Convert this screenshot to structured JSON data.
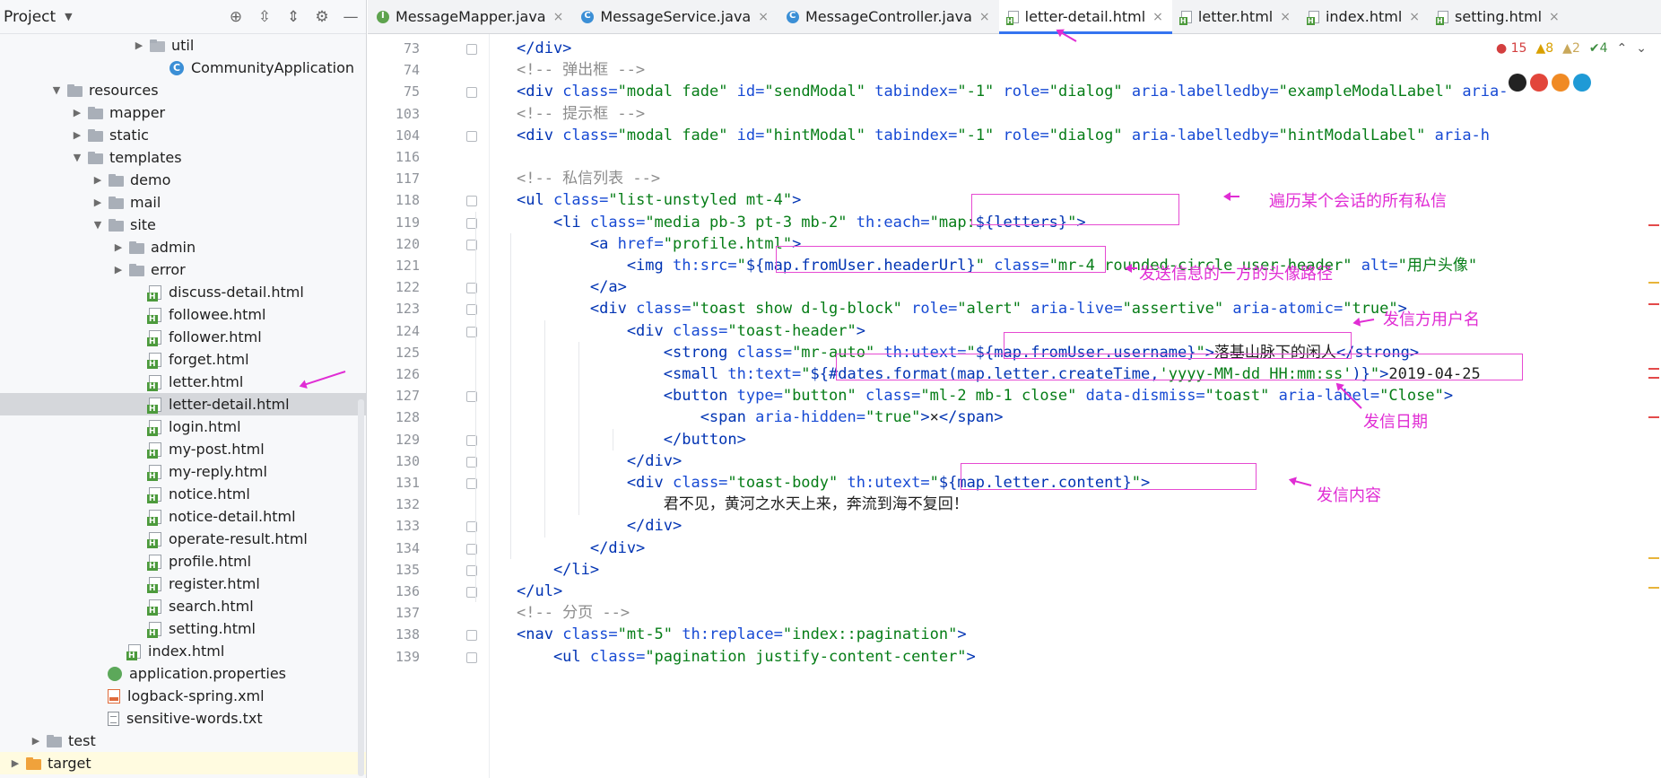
{
  "project_panel": {
    "title": "Project",
    "tree": [
      {
        "label": "util",
        "indent": 6,
        "type": "pkg",
        "arrow": "▶"
      },
      {
        "label": "CommunityApplication",
        "indent": 7,
        "type": "cls",
        "arrow": ""
      },
      {
        "label": "resources",
        "indent": 2,
        "type": "folder",
        "arrow": "▼"
      },
      {
        "label": "mapper",
        "indent": 3,
        "type": "folder",
        "arrow": "▶"
      },
      {
        "label": "static",
        "indent": 3,
        "type": "folder",
        "arrow": "▶"
      },
      {
        "label": "templates",
        "indent": 3,
        "type": "folder",
        "arrow": "▼"
      },
      {
        "label": "demo",
        "indent": 4,
        "type": "folder",
        "arrow": "▶"
      },
      {
        "label": "mail",
        "indent": 4,
        "type": "folder",
        "arrow": "▶"
      },
      {
        "label": "site",
        "indent": 4,
        "type": "folder",
        "arrow": "▼"
      },
      {
        "label": "admin",
        "indent": 5,
        "type": "folder",
        "arrow": "▶"
      },
      {
        "label": "error",
        "indent": 5,
        "type": "folder",
        "arrow": "▶"
      },
      {
        "label": "discuss-detail.html",
        "indent": 6,
        "type": "html",
        "arrow": ""
      },
      {
        "label": "followee.html",
        "indent": 6,
        "type": "html",
        "arrow": ""
      },
      {
        "label": "follower.html",
        "indent": 6,
        "type": "html",
        "arrow": ""
      },
      {
        "label": "forget.html",
        "indent": 6,
        "type": "html",
        "arrow": ""
      },
      {
        "label": "letter.html",
        "indent": 6,
        "type": "html",
        "arrow": ""
      },
      {
        "label": "letter-detail.html",
        "indent": 6,
        "type": "html",
        "arrow": "",
        "selected": true
      },
      {
        "label": "login.html",
        "indent": 6,
        "type": "html",
        "arrow": ""
      },
      {
        "label": "my-post.html",
        "indent": 6,
        "type": "html",
        "arrow": ""
      },
      {
        "label": "my-reply.html",
        "indent": 6,
        "type": "html",
        "arrow": ""
      },
      {
        "label": "notice.html",
        "indent": 6,
        "type": "html",
        "arrow": ""
      },
      {
        "label": "notice-detail.html",
        "indent": 6,
        "type": "html",
        "arrow": ""
      },
      {
        "label": "operate-result.html",
        "indent": 6,
        "type": "html",
        "arrow": ""
      },
      {
        "label": "profile.html",
        "indent": 6,
        "type": "html",
        "arrow": ""
      },
      {
        "label": "register.html",
        "indent": 6,
        "type": "html",
        "arrow": ""
      },
      {
        "label": "search.html",
        "indent": 6,
        "type": "html",
        "arrow": ""
      },
      {
        "label": "setting.html",
        "indent": 6,
        "type": "html",
        "arrow": ""
      },
      {
        "label": "index.html",
        "indent": 5,
        "type": "html",
        "arrow": ""
      },
      {
        "label": "application.properties",
        "indent": 4,
        "type": "props",
        "arrow": ""
      },
      {
        "label": "logback-spring.xml",
        "indent": 4,
        "type": "xml",
        "arrow": ""
      },
      {
        "label": "sensitive-words.txt",
        "indent": 4,
        "type": "txt",
        "arrow": ""
      },
      {
        "label": "test",
        "indent": 1,
        "type": "folder",
        "arrow": "▶"
      },
      {
        "label": "target",
        "indent": 0,
        "type": "folder-orange",
        "arrow": "▶",
        "highlight": true
      }
    ]
  },
  "tabs": [
    {
      "label": "MessageMapper.java",
      "icon": "iface"
    },
    {
      "label": "MessageService.java",
      "icon": "cls"
    },
    {
      "label": "MessageController.java",
      "icon": "cls"
    },
    {
      "label": "letter-detail.html",
      "icon": "html",
      "active": true
    },
    {
      "label": "letter.html",
      "icon": "html"
    },
    {
      "label": "index.html",
      "icon": "html"
    },
    {
      "label": "setting.html",
      "icon": "html"
    }
  ],
  "inspections": {
    "errors": "15",
    "warnings": "8",
    "weak": "2",
    "ok": "4"
  },
  "line_numbers": [
    "73",
    "74",
    "75",
    "103",
    "104",
    "116",
    "117",
    "118",
    "119",
    "120",
    "121",
    "122",
    "123",
    "124",
    "125",
    "126",
    "127",
    "128",
    "129",
    "130",
    "131",
    "132",
    "133",
    "134",
    "135",
    "136",
    "137",
    "138",
    "139"
  ],
  "code_lines": [
    [
      [
        "tag",
        "</div>"
      ]
    ],
    [
      [
        "cmt",
        "<!-- 弹出框 -->"
      ]
    ],
    [
      [
        "tag",
        "<div "
      ],
      [
        "attr",
        "class="
      ],
      [
        "val",
        "\"modal fade\" "
      ],
      [
        "attr",
        "id="
      ],
      [
        "val",
        "\"sendModal\" "
      ],
      [
        "attr",
        "tabindex="
      ],
      [
        "val",
        "\"-1\" "
      ],
      [
        "attr",
        "role="
      ],
      [
        "val",
        "\"dialog\" "
      ],
      [
        "attr",
        "aria-labelledby="
      ],
      [
        "val",
        "\"exampleModalLabel\" "
      ],
      [
        "attr",
        "aria-"
      ]
    ],
    [
      [
        "cmt",
        "<!-- 提示框 -->"
      ]
    ],
    [
      [
        "tag",
        "<div "
      ],
      [
        "attr",
        "class="
      ],
      [
        "val",
        "\"modal fade\" "
      ],
      [
        "attr",
        "id="
      ],
      [
        "val",
        "\"hintModal\" "
      ],
      [
        "attr",
        "tabindex="
      ],
      [
        "val",
        "\"-1\" "
      ],
      [
        "attr",
        "role="
      ],
      [
        "val",
        "\"dialog\" "
      ],
      [
        "attr",
        "aria-labelledby="
      ],
      [
        "val",
        "\"hintModalLabel\" "
      ],
      [
        "attr",
        "aria-h"
      ]
    ],
    [],
    [
      [
        "cmt",
        "<!-- 私信列表 -->"
      ]
    ],
    [
      [
        "tag",
        "<ul "
      ],
      [
        "attr",
        "class="
      ],
      [
        "val",
        "\"list-unstyled mt-4\""
      ],
      [
        "tag",
        ">"
      ]
    ],
    [
      [
        "tag",
        "    <li "
      ],
      [
        "attr",
        "class="
      ],
      [
        "val",
        "\"media pb-3 pt-3 mb-2\" "
      ],
      [
        "attr",
        "th:each="
      ],
      [
        "val",
        "\"map:"
      ],
      [
        "expr",
        "${letters}"
      ],
      [
        "val",
        "\""
      ],
      [
        "tag",
        ">"
      ]
    ],
    [
      [
        "tag",
        "        <a "
      ],
      [
        "attr",
        "href="
      ],
      [
        "val",
        "\"profile.html\""
      ],
      [
        "tag",
        ">"
      ]
    ],
    [
      [
        "tag",
        "            <img "
      ],
      [
        "attr",
        "th:src="
      ],
      [
        "val",
        "\""
      ],
      [
        "expr",
        "${map.fromUser.headerUrl}"
      ],
      [
        "val",
        "\" "
      ],
      [
        "attr",
        "class="
      ],
      [
        "val",
        "\"mr-4 rounded-circle user-header\" "
      ],
      [
        "attr",
        "alt="
      ],
      [
        "val",
        "\"用户头像\""
      ]
    ],
    [
      [
        "tag",
        "        </a>"
      ]
    ],
    [
      [
        "tag",
        "        <div "
      ],
      [
        "attr",
        "class="
      ],
      [
        "val",
        "\"toast show d-lg-block\" "
      ],
      [
        "attr",
        "role="
      ],
      [
        "val",
        "\"alert\" "
      ],
      [
        "attr",
        "aria-live="
      ],
      [
        "val",
        "\"assertive\" "
      ],
      [
        "attr",
        "aria-atomic="
      ],
      [
        "val",
        "\"true\""
      ],
      [
        "tag",
        ">"
      ]
    ],
    [
      [
        "tag",
        "            <div "
      ],
      [
        "attr",
        "class="
      ],
      [
        "val",
        "\"toast-header\""
      ],
      [
        "tag",
        ">"
      ]
    ],
    [
      [
        "tag",
        "                <strong "
      ],
      [
        "attr",
        "class="
      ],
      [
        "val",
        "\"mr-auto\" "
      ],
      [
        "attr",
        "th:utext="
      ],
      [
        "val",
        "\""
      ],
      [
        "expr",
        "${map.fromUser.username}"
      ],
      [
        "val",
        "\""
      ],
      [
        "tag",
        ">"
      ],
      [
        "txt",
        "落基山脉下的闲人"
      ],
      [
        "tag",
        "</strong>"
      ]
    ],
    [
      [
        "tag",
        "                <small "
      ],
      [
        "attr",
        "th:text="
      ],
      [
        "val",
        "\""
      ],
      [
        "expr",
        "${#dates.format(map.letter.createTime,"
      ],
      [
        "val",
        "'yyyy-MM-dd HH:mm:ss'"
      ],
      [
        "expr",
        ")}"
      ],
      [
        "val",
        "\""
      ],
      [
        "tag",
        ">"
      ],
      [
        "txt",
        "2019-04-25"
      ]
    ],
    [
      [
        "tag",
        "                <button "
      ],
      [
        "attr",
        "type="
      ],
      [
        "val",
        "\"button\" "
      ],
      [
        "attr",
        "class="
      ],
      [
        "val",
        "\"ml-2 mb-1 close\" "
      ],
      [
        "attr",
        "data-dismiss="
      ],
      [
        "val",
        "\"toast\" "
      ],
      [
        "attr",
        "aria-label="
      ],
      [
        "val",
        "\"Close\""
      ],
      [
        "tag",
        ">"
      ]
    ],
    [
      [
        "tag",
        "                    <span "
      ],
      [
        "attr",
        "aria-hidden="
      ],
      [
        "val",
        "\"true\""
      ],
      [
        "tag",
        ">"
      ],
      [
        "txt",
        "×"
      ],
      [
        "tag",
        "</span>"
      ]
    ],
    [
      [
        "tag",
        "                </button>"
      ]
    ],
    [
      [
        "tag",
        "            </div>"
      ]
    ],
    [
      [
        "tag",
        "            <div "
      ],
      [
        "attr",
        "class="
      ],
      [
        "val",
        "\"toast-body\" "
      ],
      [
        "attr",
        "th:utext="
      ],
      [
        "val",
        "\""
      ],
      [
        "expr",
        "${map.letter.content}"
      ],
      [
        "val",
        "\""
      ],
      [
        "tag",
        ">"
      ]
    ],
    [
      [
        "txt",
        "                君不见，黄河之水天上来，奔流到海不复回！"
      ]
    ],
    [
      [
        "tag",
        "            </div>"
      ]
    ],
    [
      [
        "tag",
        "        </div>"
      ]
    ],
    [
      [
        "tag",
        "    </li>"
      ]
    ],
    [
      [
        "tag",
        "</ul>"
      ]
    ],
    [
      [
        "cmt",
        "<!-- 分页 -->"
      ]
    ],
    [
      [
        "tag",
        "<nav "
      ],
      [
        "attr",
        "class="
      ],
      [
        "val",
        "\"mt-5\" "
      ],
      [
        "attr",
        "th:replace="
      ],
      [
        "val",
        "\"index::pagination\""
      ],
      [
        "tag",
        ">"
      ]
    ],
    [
      [
        "tag",
        "    <ul "
      ],
      [
        "attr",
        "class="
      ],
      [
        "val",
        "\"pagination justify-content-center\""
      ],
      [
        "tag",
        ">"
      ]
    ]
  ],
  "annotations": {
    "a1": "遍历某个会话的所有私信",
    "a2": "发送信息的一方的头像路径",
    "a3": "发信方用户名",
    "a4": "发信日期",
    "a5": "发信内容"
  }
}
